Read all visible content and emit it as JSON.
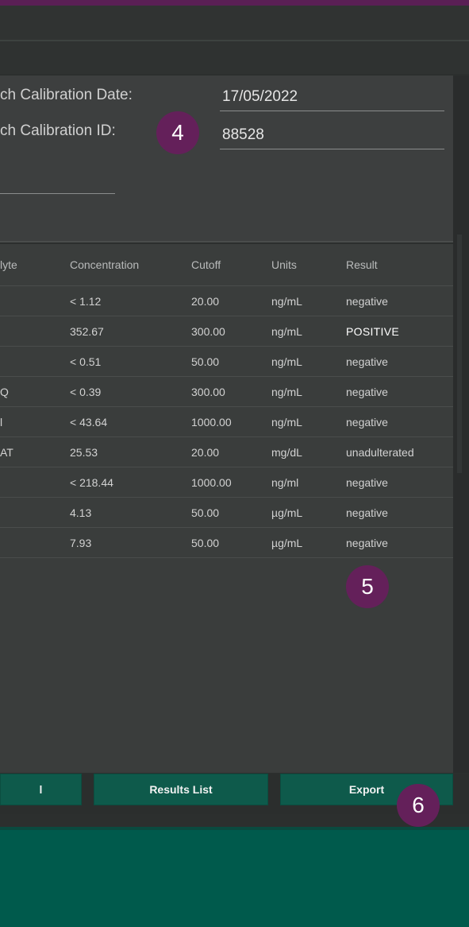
{
  "calibration": {
    "date_label": "ch Calibration Date:",
    "date_value": "17/05/2022",
    "id_label": "ch Calibration ID:",
    "id_value": "88528"
  },
  "table": {
    "headers": [
      "lyte",
      "Concentration",
      "Cutoff",
      "Units",
      "Result"
    ],
    "rows": [
      [
        "",
        "< 1.12",
        "20.00",
        "ng/mL",
        "negative"
      ],
      [
        "",
        "352.67",
        "300.00",
        "ng/mL",
        "POSITIVE"
      ],
      [
        "",
        "< 0.51",
        "50.00",
        "ng/mL",
        "negative"
      ],
      [
        "Q",
        "< 0.39",
        "300.00",
        "ng/mL",
        "negative"
      ],
      [
        "l",
        "< 43.64",
        "1000.00",
        "ng/mL",
        "negative"
      ],
      [
        "AT",
        "25.53",
        "20.00",
        "mg/dL",
        "unadulterated"
      ],
      [
        "",
        "< 218.44",
        "1000.00",
        "ng/ml",
        "negative"
      ],
      [
        "",
        "4.13",
        "50.00",
        "µg/mL",
        "negative"
      ],
      [
        "",
        "7.93",
        "50.00",
        "µg/mL",
        "negative"
      ]
    ]
  },
  "buttons": {
    "left_label": "l",
    "results_list_label": "Results List",
    "export_label": "Export"
  },
  "badges": {
    "step4": "4",
    "step5": "5",
    "step6": "6"
  },
  "colors": {
    "panel_bg": "#3d3f3f",
    "button_green": "#0e5a4b",
    "badge_purple": "#64205a",
    "footer_green": "#005a4c"
  }
}
